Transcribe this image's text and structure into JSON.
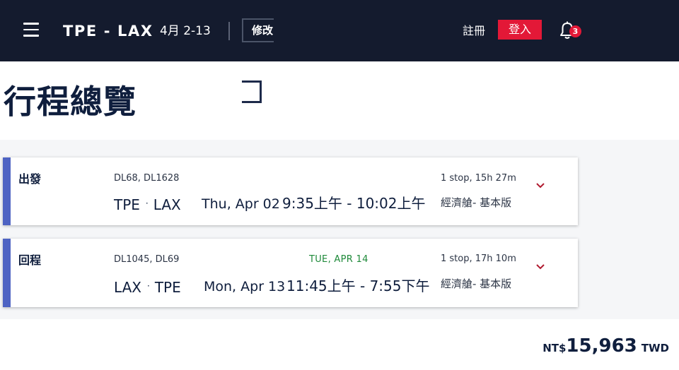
{
  "header": {
    "menu_icon": "hamburger-menu-icon",
    "route_title": "TPE - LAX",
    "trip_dates": "4月 2-13",
    "modify_label": "修改",
    "register_label": "註冊",
    "login_label": "登入",
    "notification_icon": "bell-icon",
    "notification_count": "3",
    "colors": {
      "bar": "#141b2e",
      "login_button": "#e31837",
      "badge": "#e31837"
    }
  },
  "page": {
    "title": "行程總覽"
  },
  "flights": [
    {
      "leg_label": "出發",
      "flight_numbers": "DL68, DL1628",
      "origin": "TPE",
      "separator": "·",
      "destination": "LAX",
      "date": "Thu, Apr 02",
      "times": "9:35上午 - 10:02上午",
      "stops": "1 stop, 15h 27m",
      "cabin": "經濟艙- 基本版",
      "expand_icon": "chevron-down-icon"
    },
    {
      "leg_label": "回程",
      "flight_numbers": "DL1045, DL69",
      "origin": "LAX",
      "separator": "·",
      "destination": "TPE",
      "date_change_notice": "TUE, APR 14",
      "date": "Mon, Apr 13",
      "times": "11:45上午 - 7:55下午",
      "stops": "1 stop, 17h 10m",
      "cabin": "經濟艙- 基本版",
      "expand_icon": "chevron-down-icon"
    }
  ],
  "price": {
    "currency_prefix": "NT$",
    "amount": "15,963",
    "currency_code": "TWD"
  },
  "colors": {
    "card_accent": "#4e63c3",
    "chevron": "#b01a2f",
    "date_change": "#1f8a3a",
    "title": "#0f1e3d"
  }
}
